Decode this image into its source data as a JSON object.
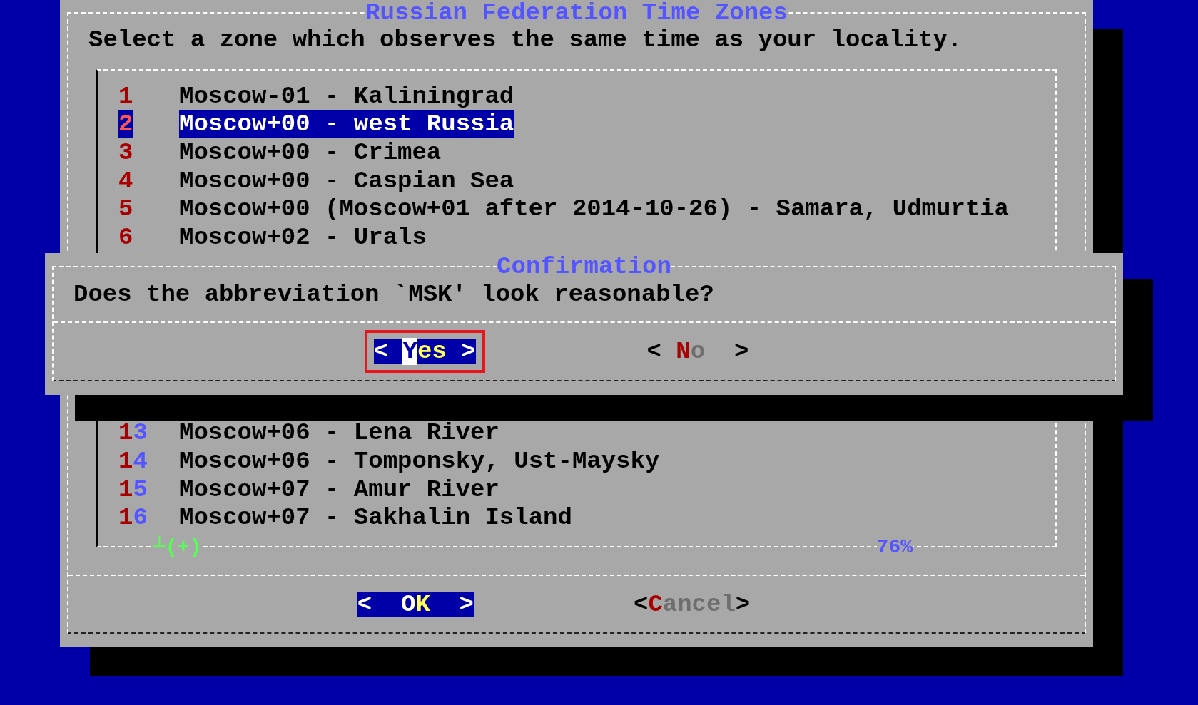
{
  "main_dialog": {
    "title": "Russian Federation Time Zones",
    "prompt": "Select a zone which observes the same time as your locality.",
    "list": {
      "groups": [
        {
          "items": [
            {
              "number": "1",
              "label": "Moscow-01 - Kaliningrad",
              "selected": false
            },
            {
              "number": "2",
              "label": "Moscow+00 - west Russia",
              "selected": true
            },
            {
              "number": "3",
              "label": "Moscow+00 - Crimea",
              "selected": false
            },
            {
              "number": "4",
              "label": "Moscow+00 - Caspian Sea",
              "selected": false
            },
            {
              "number": "5",
              "label": "Moscow+00 (Moscow+01 after 2014-10-26) - Samara, Udmurtia",
              "selected": false
            },
            {
              "number": "6",
              "label": "Moscow+02 - Urals",
              "selected": false
            }
          ]
        },
        {
          "items": [
            {
              "number": "13",
              "label": "Moscow+06 - Lena River",
              "selected": false
            },
            {
              "number": "14",
              "label": "Moscow+06 - Tomponsky, Ust-Maysky",
              "selected": false
            },
            {
              "number": "15",
              "label": "Moscow+07 - Amur River",
              "selected": false
            },
            {
              "number": "16",
              "label": "Moscow+07 - Sakhalin Island",
              "selected": false
            }
          ]
        }
      ],
      "scroll_marker": "┴(+)",
      "percent": "76%"
    },
    "buttons": [
      {
        "open": "<",
        "label": "OK",
        "close": ">",
        "selected": true
      },
      {
        "open": "<",
        "label": "Cancel",
        "close": ">",
        "selected": false
      }
    ]
  },
  "confirmation_dialog": {
    "title": "Confirmation",
    "message": "Does the abbreviation `MSK' look reasonable?",
    "buttons": [
      {
        "open": "<",
        "label": "Yes",
        "close": ">",
        "selected": true,
        "cursor": true,
        "highlighted": true
      },
      {
        "open": "<",
        "label": "No",
        "close": ">",
        "selected": false,
        "cursor": false,
        "highlighted": false
      }
    ]
  }
}
